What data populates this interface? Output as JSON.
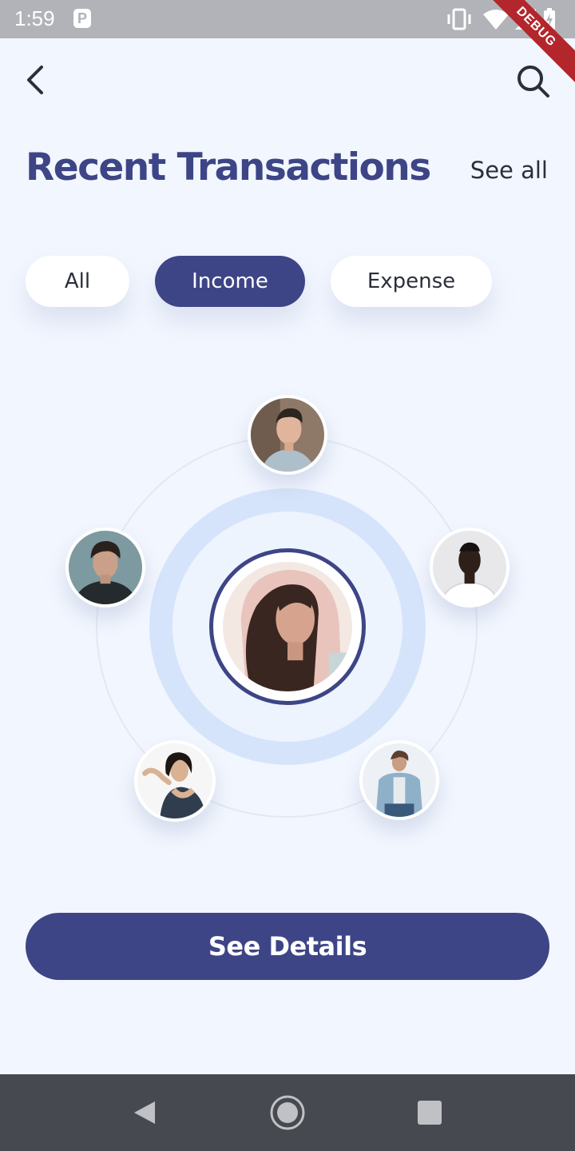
{
  "status_bar": {
    "time": "1:59",
    "notification_icon": "parking-icon",
    "icons": [
      "vibrate-icon",
      "wifi-icon",
      "signal-icon",
      "battery-charging-icon"
    ],
    "debug_label": "DEBUG"
  },
  "header": {
    "back_icon": "chevron-left-icon",
    "search_icon": "search-icon",
    "title": "Recent Transactions",
    "see_all_label": "See all"
  },
  "filters": [
    {
      "label": "All",
      "active": false
    },
    {
      "label": "Income",
      "active": true
    },
    {
      "label": "Expense",
      "active": false
    }
  ],
  "contacts": {
    "center": "avatar-woman-hooded",
    "orbit": [
      "avatar-man-top",
      "avatar-man-right",
      "avatar-man-bottom-right",
      "avatar-woman-bottom-left",
      "avatar-man-left"
    ]
  },
  "actions": {
    "details_label": "See Details"
  },
  "nav_bar": {
    "buttons": [
      "back-triangle-icon",
      "home-circle-icon",
      "recents-square-icon"
    ]
  },
  "colors": {
    "accent": "#3d4586",
    "background": "#f2f6fe",
    "ring": "#d6e4fb",
    "status_bar": "#b1b3b8",
    "nav_bar": "#464a50"
  }
}
